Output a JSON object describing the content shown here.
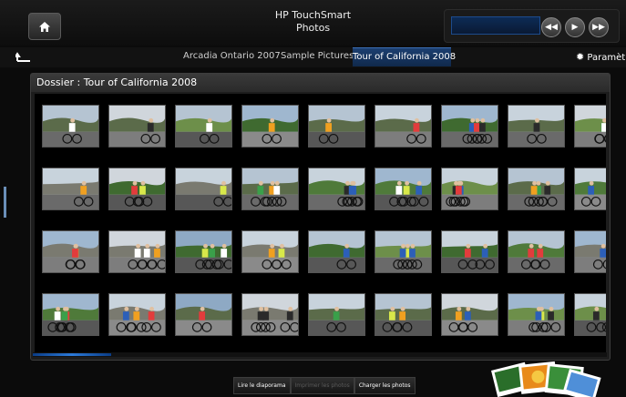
{
  "app": {
    "title_line1": "HP TouchSmart",
    "title_line2": "Photos"
  },
  "nav": {
    "tabs": [
      {
        "label": "Arcadia Ontario 2007"
      },
      {
        "label": "Sample Pictures"
      },
      {
        "label": "Tour of California 2008"
      }
    ],
    "active_tab": "Tour of California 2008",
    "settings_label": "Paramètres"
  },
  "panel": {
    "title": "Dossier : Tour of California 2008"
  },
  "photos": {
    "rows": 4,
    "columns_visible": 9,
    "last_column_partial": true,
    "scroll_position": 0.0
  },
  "actions": {
    "slideshow_label": "Lire le diaporama",
    "print_label": "Imprimer les photos",
    "load_label": "Charger les photos"
  },
  "colors": {
    "accent_blue": "#1c3f70",
    "scroll_blue": "#2c7ad8",
    "panel_bg": "#1d1d1d",
    "background": "#0b0b0b"
  },
  "icons": {
    "home": "home-icon",
    "back": "back-arrow-icon",
    "settings": "gear-icon",
    "rewind": "rewind-icon",
    "play": "play-icon",
    "forward": "fast-forward-icon"
  }
}
